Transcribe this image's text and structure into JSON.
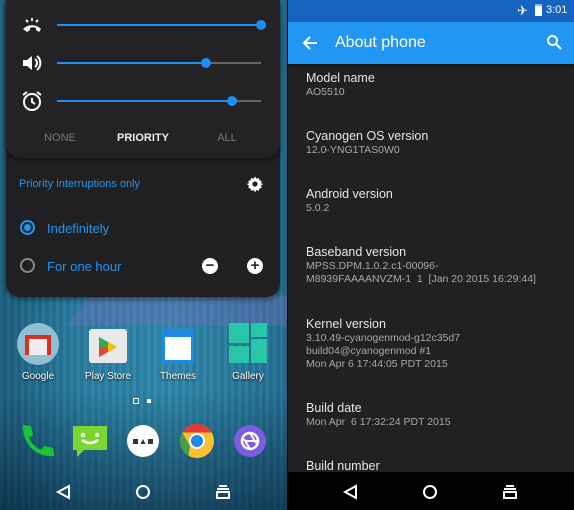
{
  "left": {
    "sliders": [
      {
        "icon": "ringer-icon",
        "value": 100
      },
      {
        "icon": "volume-icon",
        "value": 73
      },
      {
        "icon": "alarm-icon",
        "value": 86
      }
    ],
    "modes": [
      "NONE",
      "PRIORITY",
      "ALL"
    ],
    "selected_mode": "PRIORITY",
    "priority_label": "Priority interruptions only",
    "options": [
      {
        "label": "Indefinitely",
        "selected": true
      },
      {
        "label": "For one hour",
        "selected": false
      }
    ],
    "apps": [
      {
        "label": "Google"
      },
      {
        "label": "Play Store"
      },
      {
        "label": "Themes"
      },
      {
        "label": "Gallery"
      }
    ],
    "dock": [
      "phone-icon",
      "messaging-icon",
      "app-drawer-icon",
      "chrome-icon",
      "camera-icon"
    ]
  },
  "right": {
    "status": {
      "time": "3:01"
    },
    "title": "About phone",
    "items": [
      {
        "title": "Model name",
        "value": "AO5510"
      },
      {
        "title": "Cyanogen OS version",
        "value": "12.0-YNG1TAS0W0"
      },
      {
        "title": "Android version",
        "value": "5.0.2"
      },
      {
        "title": "Baseband version",
        "value": "MPSS.DPM.1.0.2.c1-00096-\nM8939FAAAANVZM-1  1  [Jan 20 2015 16:29:44]"
      },
      {
        "title": "Kernel version",
        "value": "3.10.49-cyanogenmod-g12c35d7\nbuild04@cyanogenmod #1\nMon Apr 6 17:44:05 PDT 2015"
      },
      {
        "title": "Build date",
        "value": "Mon Apr  6 17:32:24 PDT 2015"
      },
      {
        "title": "Build number",
        "value": ""
      }
    ]
  },
  "colors": {
    "accent": "#2196f3",
    "toolbar": "#2196f3",
    "statusbar": "#1565c0",
    "panel": "#202022"
  }
}
